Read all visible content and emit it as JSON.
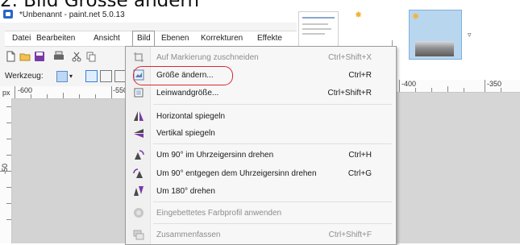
{
  "heading": "2. Bild Grösse ändern",
  "window": {
    "title": "*Unbenannt - paint.net 5.0.13",
    "menu": [
      "Datei",
      "Bearbeiten",
      "Ansicht",
      "Bild",
      "Ebenen",
      "Korrekturen",
      "Effekte"
    ],
    "active_menu": "Bild",
    "tool_label": "Werkzeug:",
    "ruler_unit": "px",
    "ruler_labels": [
      "-600",
      "-550",
      "-400",
      "-350"
    ],
    "vertical_ruler_label": "-50"
  },
  "dropdown": {
    "items": [
      {
        "label": "Auf Markierung zuschneiden",
        "shortcut": "Ctrl+Shift+X",
        "icon": "crop-icon",
        "enabled": false
      },
      {
        "label": "Größe ändern...",
        "shortcut": "Ctrl+R",
        "icon": "resize-icon",
        "enabled": true,
        "highlighted": true
      },
      {
        "label": "Leinwandgröße...",
        "shortcut": "Ctrl+Shift+R",
        "icon": "canvas-size-icon",
        "enabled": true
      },
      {
        "label": "Horizontal spiegeln",
        "shortcut": "",
        "icon": "flip-horizontal-icon",
        "enabled": true
      },
      {
        "label": "Vertikal spiegeln",
        "shortcut": "",
        "icon": "flip-vertical-icon",
        "enabled": true
      },
      {
        "label": "Um 90° im Uhrzeigersinn drehen",
        "shortcut": "Ctrl+H",
        "icon": "rotate-cw-icon",
        "enabled": true
      },
      {
        "label": "Um 90° entgegen dem Uhrzeigersinn drehen",
        "shortcut": "Ctrl+G",
        "icon": "rotate-ccw-icon",
        "enabled": true
      },
      {
        "label": "Um 180° drehen",
        "shortcut": "",
        "icon": "rotate-180-icon",
        "enabled": true
      },
      {
        "label": "Eingebettetes Farbprofil anwenden",
        "shortcut": "",
        "icon": "color-profile-icon",
        "enabled": false
      },
      {
        "label": "Zusammenfassen",
        "shortcut": "Ctrl+Shift+F",
        "icon": "flatten-icon",
        "enabled": false
      }
    ]
  },
  "colors": {
    "accent": "#2a66c8",
    "highlight_ring": "#d9272e"
  }
}
